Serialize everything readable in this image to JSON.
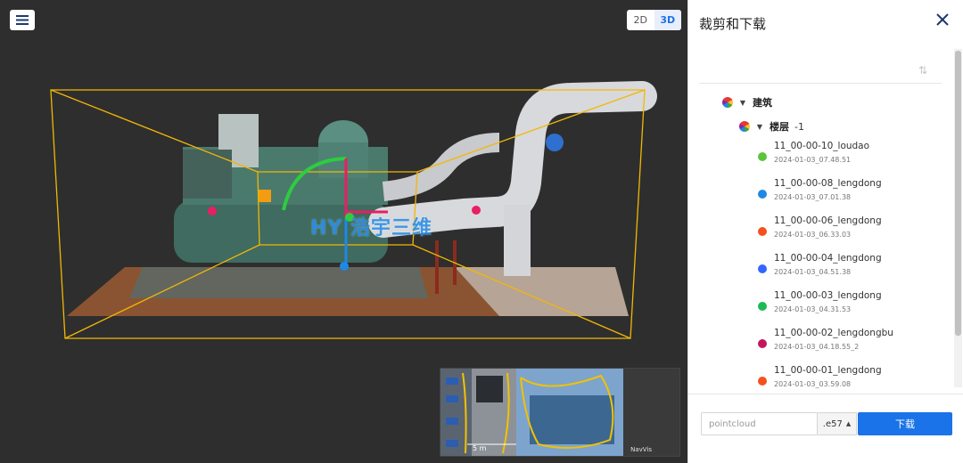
{
  "viewer": {
    "menu_icon": "hamburger-menu-icon",
    "view_modes": [
      {
        "label": "2D",
        "active": false
      },
      {
        "label": "3D",
        "active": true
      }
    ],
    "watermark": "HY 浩宇三维",
    "minimap": {
      "scale_label": "5 m",
      "attribution": "NavVis"
    },
    "colors": {
      "bounding_box": "#f2b705",
      "axis_x": "#e91e63",
      "axis_y": "#2ecc40",
      "axis_z": "#1e88e5"
    }
  },
  "panel": {
    "title": "裁剪和下载",
    "close_icon": "close-icon",
    "sort_icon": "sort-icon",
    "tree": {
      "root": {
        "label": "建筑",
        "expanded": true
      },
      "floor": {
        "label": "楼层",
        "suffix": "-1",
        "expanded": true
      },
      "scans": [
        {
          "name": "11_00-00-10_loudao",
          "date": "2024-01-03_07.48.51",
          "color": "#5ac53a"
        },
        {
          "name": "11_00-00-08_lengdong",
          "date": "2024-01-03_07.01.38",
          "color": "#1e88e5"
        },
        {
          "name": "11_00-00-06_lengdong",
          "date": "2024-01-03_06.33.03",
          "color": "#f4511e"
        },
        {
          "name": "11_00-00-04_lengdong",
          "date": "2024-01-03_04.51.38",
          "color": "#3366ff"
        },
        {
          "name": "11_00-00-03_lengdong",
          "date": "2024-01-03_04.31.53",
          "color": "#1db954"
        },
        {
          "name": "11_00-00-02_lengdongbu",
          "date": "2024-01-03_04.18.55_2",
          "color": "#c2185b"
        },
        {
          "name": "11_00-00-01_lengdong",
          "date": "2024-01-03_03.59.08",
          "color": "#f4511e"
        }
      ]
    },
    "footer": {
      "filename_placeholder": "pointcloud",
      "format": ".e57",
      "download_label": "下载",
      "accent": "#1a73e8"
    }
  }
}
